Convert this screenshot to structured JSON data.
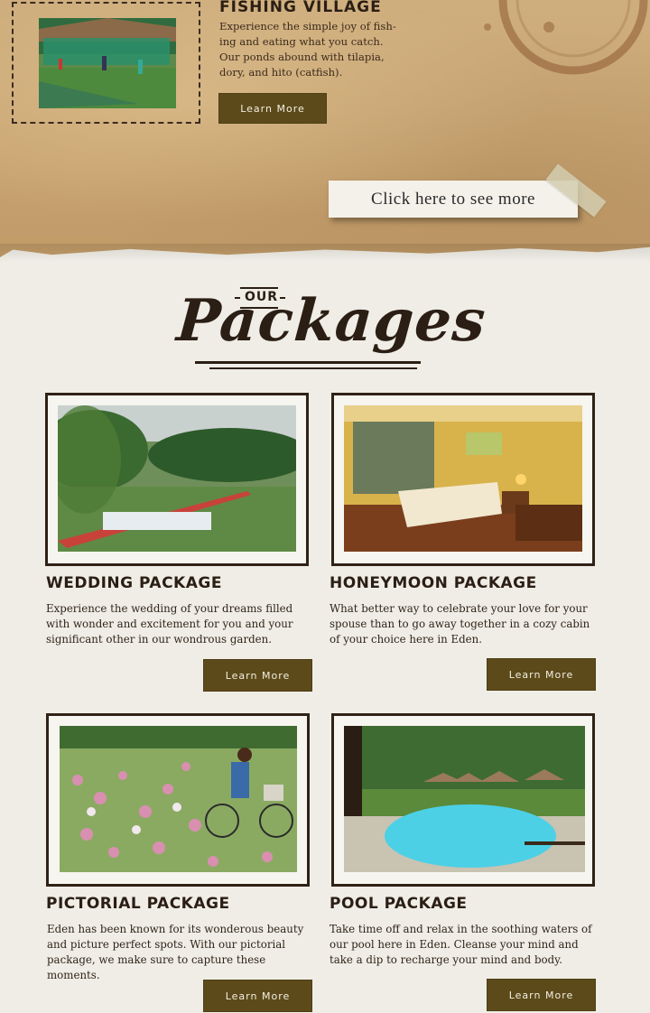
{
  "fishing": {
    "title": "Fishing Village",
    "description": "Experience the simple joy of fish-ing and eating what you catch. Our ponds abound with tilapia, dory, and hito (catfish).",
    "button_label": "Learn More"
  },
  "see_more_label": "Click here to see more",
  "section": {
    "our_label": "Our",
    "title": "Packages"
  },
  "packages": [
    {
      "title": "Wedding Package",
      "description": "Experience the wedding of your dreams filled with wonder and excitement for you and your significant other in our wondrous garden.",
      "button_label": "Learn More"
    },
    {
      "title": "Honeymoon Package",
      "description": "What better way to celebrate your love for your spouse than to go away together in a cozy cabin of your choice here in Eden.",
      "button_label": "Learn More"
    },
    {
      "title": "Pictorial Package",
      "description": "Eden has been known for its wonderous beauty and picture perfect spots. With our pictorial package, we make sure to capture these moments.",
      "button_label": "Learn More"
    },
    {
      "title": "Pool Package",
      "description": "Take time off and relax in the soothing waters of our pool here in Eden. Cleanse your mind and take a dip to recharge your mind and body.",
      "button_label": "Learn More"
    }
  ],
  "colors": {
    "button": "#5c4a1a",
    "text_dark": "#2b1e14",
    "kraft": "#c8a472",
    "background": "#efede6"
  }
}
